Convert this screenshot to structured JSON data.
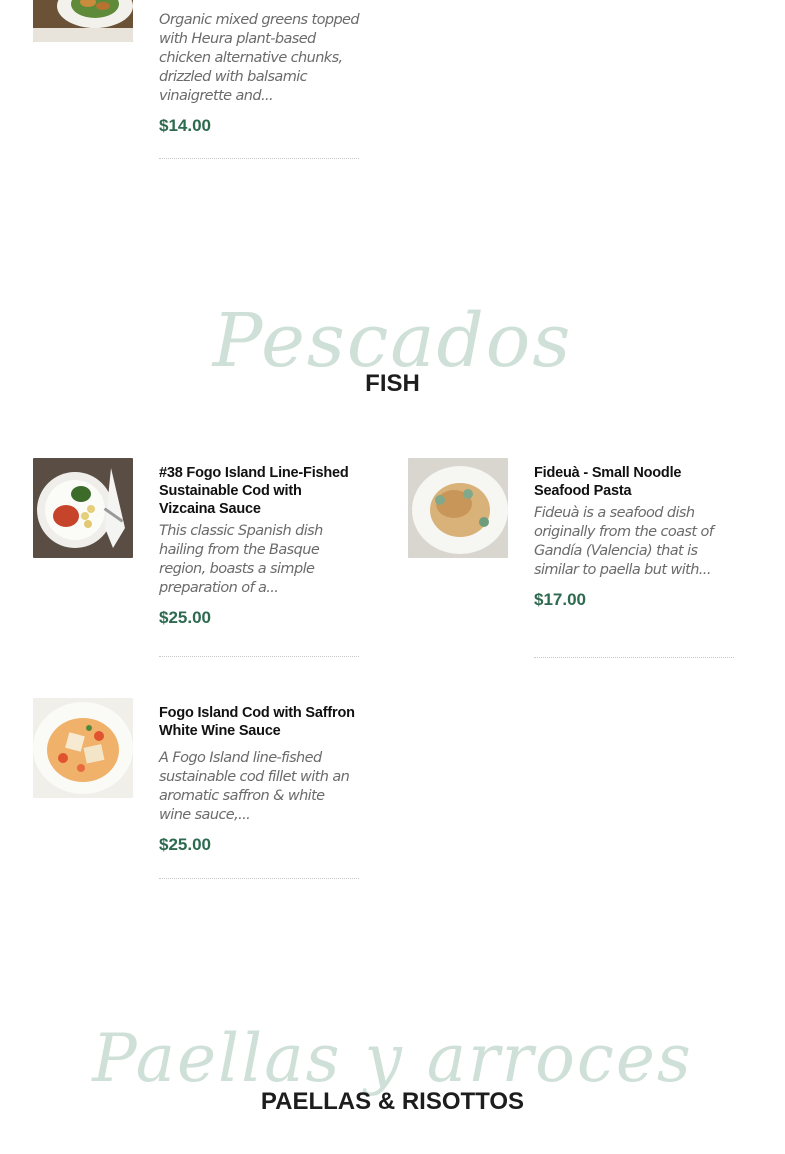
{
  "salad_item": {
    "description": "Organic mixed greens topped with Heura plant-based chicken alternative chunks, drizzled with balsamic vinaigrette and...",
    "price": "$14.00"
  },
  "fish_section": {
    "script_title": "Pescados",
    "title": "FISH",
    "items": [
      {
        "name": "#38 Fogo Island Line-Fished Sustainable Cod with Vizcaina Sauce",
        "description": "This classic Spanish dish hailing from the Basque region, boasts a simple preparation of a...",
        "price": "$25.00"
      },
      {
        "name": "Fideuà - Small Noodle Seafood Pasta",
        "description": "Fideuà is a seafood dish originally from the coast of Gandía (Valencia) that is similar to paella but with...",
        "price": "$17.00"
      },
      {
        "name": "Fogo Island Cod with Saffron White Wine Sauce",
        "description": "A Fogo Island line-fished sustainable cod fillet with an aromatic saffron & white wine sauce,...",
        "price": "$25.00"
      }
    ]
  },
  "paella_section": {
    "script_title": "Paellas y arroces",
    "title": "PAELLAS & RISOTTOS"
  },
  "colors": {
    "price": "#2e6a4f",
    "script_title": "#cfe0d8",
    "description": "#6b6b6b"
  }
}
